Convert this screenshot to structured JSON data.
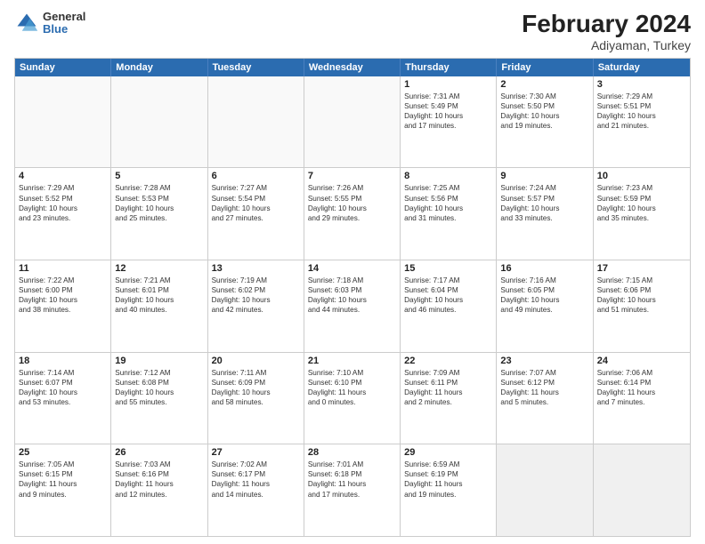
{
  "header": {
    "logo": {
      "general": "General",
      "blue": "Blue"
    },
    "title": "February 2024",
    "location": "Adiyaman, Turkey"
  },
  "weekdays": [
    "Sunday",
    "Monday",
    "Tuesday",
    "Wednesday",
    "Thursday",
    "Friday",
    "Saturday"
  ],
  "rows": [
    [
      {
        "day": "",
        "info": "",
        "empty": true
      },
      {
        "day": "",
        "info": "",
        "empty": true
      },
      {
        "day": "",
        "info": "",
        "empty": true
      },
      {
        "day": "",
        "info": "",
        "empty": true
      },
      {
        "day": "1",
        "info": "Sunrise: 7:31 AM\nSunset: 5:49 PM\nDaylight: 10 hours\nand 17 minutes."
      },
      {
        "day": "2",
        "info": "Sunrise: 7:30 AM\nSunset: 5:50 PM\nDaylight: 10 hours\nand 19 minutes."
      },
      {
        "day": "3",
        "info": "Sunrise: 7:29 AM\nSunset: 5:51 PM\nDaylight: 10 hours\nand 21 minutes."
      }
    ],
    [
      {
        "day": "4",
        "info": "Sunrise: 7:29 AM\nSunset: 5:52 PM\nDaylight: 10 hours\nand 23 minutes."
      },
      {
        "day": "5",
        "info": "Sunrise: 7:28 AM\nSunset: 5:53 PM\nDaylight: 10 hours\nand 25 minutes."
      },
      {
        "day": "6",
        "info": "Sunrise: 7:27 AM\nSunset: 5:54 PM\nDaylight: 10 hours\nand 27 minutes."
      },
      {
        "day": "7",
        "info": "Sunrise: 7:26 AM\nSunset: 5:55 PM\nDaylight: 10 hours\nand 29 minutes."
      },
      {
        "day": "8",
        "info": "Sunrise: 7:25 AM\nSunset: 5:56 PM\nDaylight: 10 hours\nand 31 minutes."
      },
      {
        "day": "9",
        "info": "Sunrise: 7:24 AM\nSunset: 5:57 PM\nDaylight: 10 hours\nand 33 minutes."
      },
      {
        "day": "10",
        "info": "Sunrise: 7:23 AM\nSunset: 5:59 PM\nDaylight: 10 hours\nand 35 minutes."
      }
    ],
    [
      {
        "day": "11",
        "info": "Sunrise: 7:22 AM\nSunset: 6:00 PM\nDaylight: 10 hours\nand 38 minutes."
      },
      {
        "day": "12",
        "info": "Sunrise: 7:21 AM\nSunset: 6:01 PM\nDaylight: 10 hours\nand 40 minutes."
      },
      {
        "day": "13",
        "info": "Sunrise: 7:19 AM\nSunset: 6:02 PM\nDaylight: 10 hours\nand 42 minutes."
      },
      {
        "day": "14",
        "info": "Sunrise: 7:18 AM\nSunset: 6:03 PM\nDaylight: 10 hours\nand 44 minutes."
      },
      {
        "day": "15",
        "info": "Sunrise: 7:17 AM\nSunset: 6:04 PM\nDaylight: 10 hours\nand 46 minutes."
      },
      {
        "day": "16",
        "info": "Sunrise: 7:16 AM\nSunset: 6:05 PM\nDaylight: 10 hours\nand 49 minutes."
      },
      {
        "day": "17",
        "info": "Sunrise: 7:15 AM\nSunset: 6:06 PM\nDaylight: 10 hours\nand 51 minutes."
      }
    ],
    [
      {
        "day": "18",
        "info": "Sunrise: 7:14 AM\nSunset: 6:07 PM\nDaylight: 10 hours\nand 53 minutes."
      },
      {
        "day": "19",
        "info": "Sunrise: 7:12 AM\nSunset: 6:08 PM\nDaylight: 10 hours\nand 55 minutes."
      },
      {
        "day": "20",
        "info": "Sunrise: 7:11 AM\nSunset: 6:09 PM\nDaylight: 10 hours\nand 58 minutes."
      },
      {
        "day": "21",
        "info": "Sunrise: 7:10 AM\nSunset: 6:10 PM\nDaylight: 11 hours\nand 0 minutes."
      },
      {
        "day": "22",
        "info": "Sunrise: 7:09 AM\nSunset: 6:11 PM\nDaylight: 11 hours\nand 2 minutes."
      },
      {
        "day": "23",
        "info": "Sunrise: 7:07 AM\nSunset: 6:12 PM\nDaylight: 11 hours\nand 5 minutes."
      },
      {
        "day": "24",
        "info": "Sunrise: 7:06 AM\nSunset: 6:14 PM\nDaylight: 11 hours\nand 7 minutes."
      }
    ],
    [
      {
        "day": "25",
        "info": "Sunrise: 7:05 AM\nSunset: 6:15 PM\nDaylight: 11 hours\nand 9 minutes."
      },
      {
        "day": "26",
        "info": "Sunrise: 7:03 AM\nSunset: 6:16 PM\nDaylight: 11 hours\nand 12 minutes."
      },
      {
        "day": "27",
        "info": "Sunrise: 7:02 AM\nSunset: 6:17 PM\nDaylight: 11 hours\nand 14 minutes."
      },
      {
        "day": "28",
        "info": "Sunrise: 7:01 AM\nSunset: 6:18 PM\nDaylight: 11 hours\nand 17 minutes."
      },
      {
        "day": "29",
        "info": "Sunrise: 6:59 AM\nSunset: 6:19 PM\nDaylight: 11 hours\nand 19 minutes."
      },
      {
        "day": "",
        "info": "",
        "empty": true,
        "shaded": true
      },
      {
        "day": "",
        "info": "",
        "empty": true,
        "shaded": true
      }
    ]
  ]
}
